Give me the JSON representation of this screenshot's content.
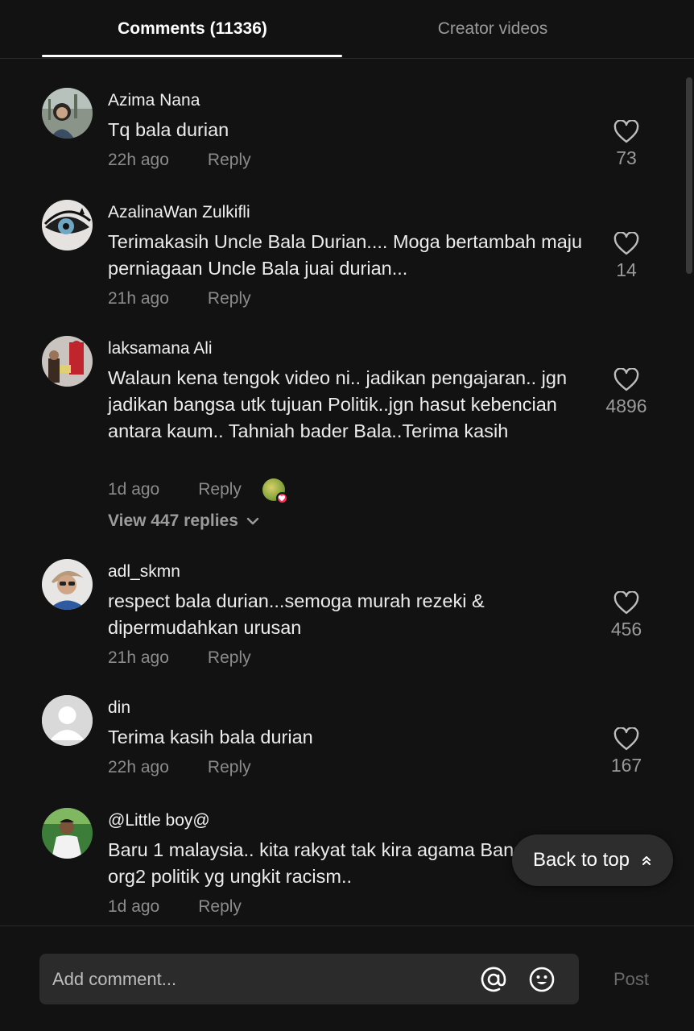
{
  "tabs": {
    "comments_label": "Comments",
    "comments_count": "(11336)",
    "creator_label": "Creator videos"
  },
  "comments": [
    {
      "username": "Azima Nana",
      "text": "Tq bala durian",
      "time": "22h ago",
      "reply": "Reply",
      "likes": "73"
    },
    {
      "username": "AzalinaWan Zulkifli",
      "text": "Terimakasih Uncle Bala Durian.... Moga bertambah maju perniagaan Uncle Bala juai durian...",
      "time": "21h ago",
      "reply": "Reply",
      "likes": "14"
    },
    {
      "username": "laksamana Ali",
      "text": "Walaun kena tengok video ni.. jadikan pengajaran.. jgn jadikan bangsa utk tujuan Politik..jgn hasut kebencian antara kaum.. Tahniah bader Bala..Terima kasih",
      "time": "1d ago",
      "reply": "Reply",
      "likes": "4896",
      "view_replies": "View 447 replies"
    },
    {
      "username": "adl_skmn",
      "text": "respect bala durian...semoga murah rezeki & dipermudahkan urusan",
      "time": "21h ago",
      "reply": "Reply",
      "likes": "456"
    },
    {
      "username": "din",
      "text": "Terima kasih bala durian",
      "time": "22h ago",
      "reply": "Reply",
      "likes": "167"
    },
    {
      "username": "@Little boy@",
      "text": "Baru 1 malaysia.. kita rakyat tak kira agama Bangsa.. org2 politik yg ungkit racism..",
      "time": "1d ago",
      "reply": "Reply"
    }
  ],
  "back_to_top": "Back to top",
  "composer": {
    "placeholder": "Add comment...",
    "post_label": "Post"
  },
  "icons": {
    "like": "heart-icon",
    "mention": "at-sign-icon",
    "emoji": "emoji-icon",
    "expand": "chevron-down-icon",
    "back_to_top": "double-chevron-up-icon"
  },
  "colors": {
    "background": "#121212",
    "text": "#ececec",
    "muted": "#8b8b8b",
    "input_bg": "#2b2b2b",
    "badge": "#fe2c55"
  }
}
